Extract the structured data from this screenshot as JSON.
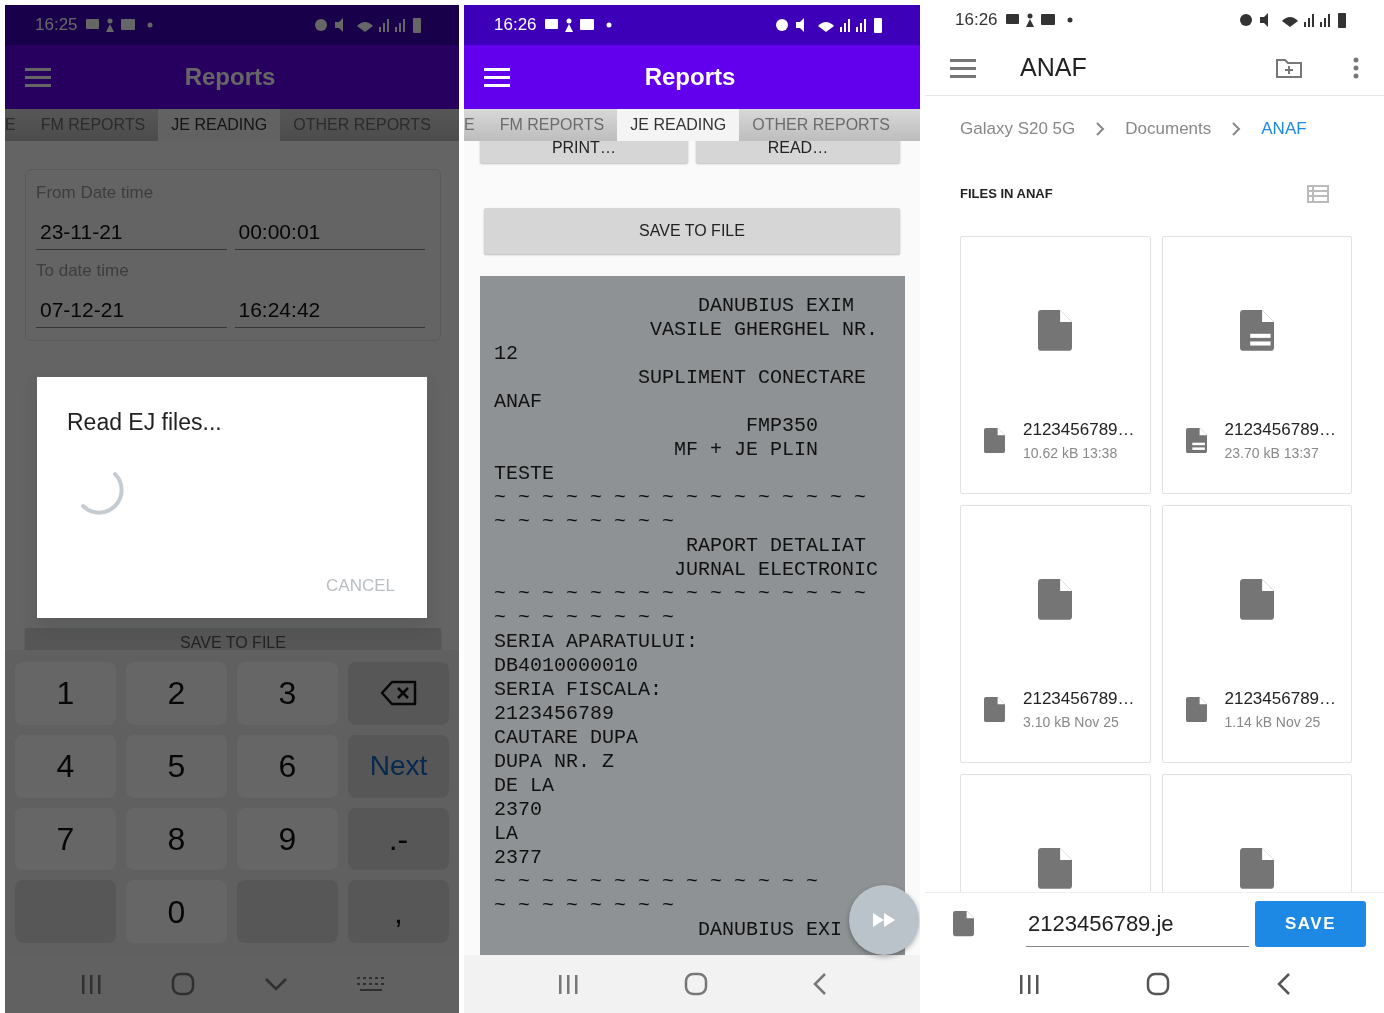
{
  "reports_dialog_screen": {
    "dimmed": true,
    "status_bar": {
      "time": "16:25"
    },
    "app_bar": {
      "title": "Reports"
    },
    "tabs": [
      {
        "label": "E",
        "selected": false
      },
      {
        "label": "FM REPORTS",
        "selected": false
      },
      {
        "label": "JE READING",
        "selected": true
      },
      {
        "label": "OTHER REPORTS",
        "selected": false
      }
    ],
    "from_label": "From Date time",
    "from_date": "23-11-21",
    "from_time": "00:00:01",
    "to_label": "To date time",
    "to_date": "07-12-21",
    "to_time": "16:24:42",
    "save_button": "SAVE TO FILE",
    "dialog": {
      "title": "Read EJ files...",
      "cancel": "CANCEL"
    },
    "keyboard": [
      {
        "kind": "char",
        "label": "1"
      },
      {
        "kind": "char",
        "label": "2"
      },
      {
        "kind": "char",
        "label": "3"
      },
      {
        "kind": "backspace"
      },
      {
        "kind": "char",
        "label": "4"
      },
      {
        "kind": "char",
        "label": "5"
      },
      {
        "kind": "char",
        "label": "6"
      },
      {
        "kind": "action",
        "label": "Next"
      },
      {
        "kind": "char",
        "label": "7"
      },
      {
        "kind": "char",
        "label": "8"
      },
      {
        "kind": "char",
        "label": "9"
      },
      {
        "kind": "symbol",
        "label": ".-"
      },
      {
        "kind": "blank"
      },
      {
        "kind": "char",
        "label": "0"
      },
      {
        "kind": "blank"
      },
      {
        "kind": "symbol",
        "label": ","
      }
    ]
  },
  "reports_receipt_screen": {
    "dimmed": false,
    "status_bar": {
      "time": "16:26"
    },
    "app_bar": {
      "title": "Reports"
    },
    "tabs": [
      {
        "label": "E",
        "selected": false
      },
      {
        "label": "FM REPORTS",
        "selected": false
      },
      {
        "label": "JE READING",
        "selected": true
      },
      {
        "label": "OTHER REPORTS",
        "selected": false
      }
    ],
    "action_buttons": [
      "PRINT…",
      "READ…"
    ],
    "save_button": "SAVE TO FILE",
    "receipt_lines": [
      "                 DANUBIUS EXIM",
      "             VASILE GHERGHEL NR.",
      "12",
      "            SUPLIMENT CONECTARE",
      "ANAF",
      "                     FMP350",
      "               MF + JE PLIN",
      "TESTE",
      "~ ~ ~ ~ ~ ~ ~ ~ ~ ~ ~ ~ ~ ~ ~ ~",
      "~ ~ ~ ~ ~ ~ ~ ~",
      "                RAPORT DETALIAT",
      "               JURNAL ELECTRONIC",
      "~ ~ ~ ~ ~ ~ ~ ~ ~ ~ ~ ~ ~ ~ ~ ~",
      "~ ~ ~ ~ ~ ~ ~ ~",
      "SERIA APARATULUI:",
      "DB4010000010",
      "SERIA FISCALA:",
      "2123456789",
      "CAUTARE DUPA",
      "DUPA NR. Z",
      "DE LA",
      "2370",
      "LA",
      "2377",
      "~ ~ ~ ~ ~ ~ ~ ~ ~ ~ ~ ~ ~ ~",
      "~ ~ ~ ~ ~ ~ ~ ~",
      "                 DANUBIUS EXI"
    ]
  },
  "file_save_screen": {
    "status_bar": {
      "time": "16:26"
    },
    "toolbar": {
      "title": "ANAF"
    },
    "breadcrumb": [
      {
        "label": "Galaxy S20 5G",
        "selected": false
      },
      {
        "label": "Documents",
        "selected": false
      },
      {
        "label": "ANAF",
        "selected": true
      }
    ],
    "section_title": "FILES IN ANAF",
    "files": [
      {
        "kind": "plain",
        "name": "2123456789…",
        "meta": "10.62 kB 13:38"
      },
      {
        "kind": "text",
        "name": "2123456789…",
        "meta": "23.70 kB 13:37"
      },
      {
        "kind": "plain",
        "name": "2123456789…",
        "meta": "3.10 kB Nov 25"
      },
      {
        "kind": "plain",
        "name": "2123456789…",
        "meta": "1.14 kB Nov 25"
      },
      {
        "kind": "plain"
      },
      {
        "kind": "plain"
      }
    ],
    "filename": "2123456789.je",
    "save_button": "SAVE"
  }
}
